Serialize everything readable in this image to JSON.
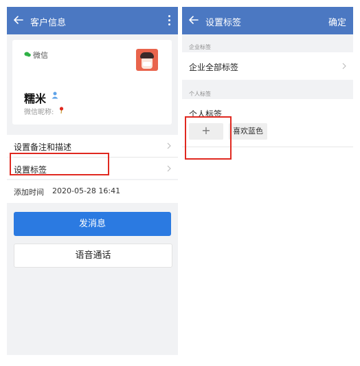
{
  "left_screen": {
    "header": {
      "title": "客户信息"
    },
    "profile": {
      "platform_label": "微信",
      "name": "糯米",
      "nickname_label": "微信昵称:"
    },
    "menu": [
      {
        "label": "设置备注和描述"
      },
      {
        "label": "设置标签"
      }
    ],
    "added_time": {
      "label": "添加时间",
      "value": "2020-05-28 16:41"
    },
    "buttons": {
      "send_message": "发消息",
      "voice_call": "语音通话"
    }
  },
  "right_screen": {
    "header": {
      "title": "设置标签",
      "confirm": "确定"
    },
    "enterprise_section": {
      "title": "企业标签",
      "item": "企业全部标签"
    },
    "personal_section": {
      "title": "个人标签",
      "heading": "个人标签",
      "add_symbol": "+",
      "tags": [
        "喜欢蓝色"
      ]
    }
  },
  "colors": {
    "header": "#4b78c2",
    "primary_button": "#2b7ae1",
    "highlight_box": "#e0281f",
    "page_background": "#f1f2f4"
  },
  "icons": {
    "left_header": [
      "back-arrow-icon",
      "more-vertical-icon"
    ],
    "right_header": [
      "back-arrow-icon"
    ],
    "profile": [
      "wechat-icon",
      "person-icon",
      "location-pin-icon",
      "avatar"
    ],
    "rows": [
      "chevron-right-icon"
    ]
  }
}
